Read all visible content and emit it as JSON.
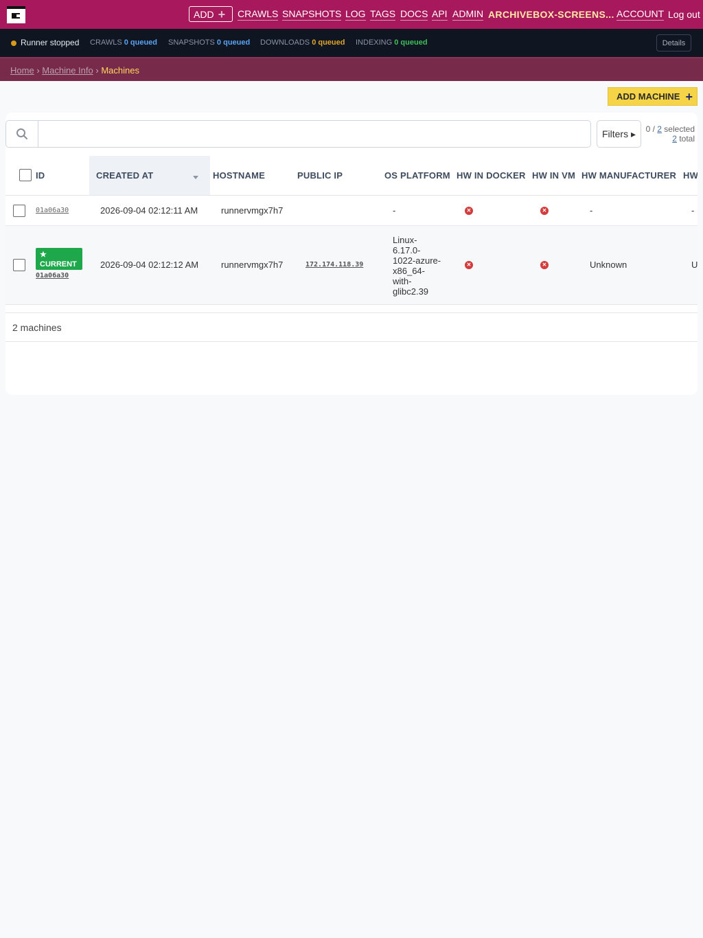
{
  "nav": {
    "add_label": "ADD",
    "links": [
      "CRAWLS",
      "SNAPSHOTS",
      "LOG",
      "TAGS",
      "DOCS",
      "API",
      "ADMIN"
    ],
    "user_label": "ARCHIVEBOX-SCREENS...",
    "account_label": "ACCOUNT",
    "logout_label": "Log out"
  },
  "status": {
    "runner": "Runner stopped",
    "crawls_label": "CRAWLS",
    "crawls_value": "0 queued",
    "snapshots_label": "SNAPSHOTS",
    "snapshots_value": "0 queued",
    "downloads_label": "DOWNLOADS",
    "downloads_value": "0 queued",
    "indexing_label": "INDEXING",
    "indexing_value": "0 queued",
    "details_label": "Details",
    "colors": {
      "crawls": "#5aa3f0",
      "snapshots": "#5aa3f0",
      "downloads": "#e0a52a",
      "indexing": "#3fbf5a",
      "runner_dot": "#d99a1a"
    }
  },
  "breadcrumb": {
    "home": "Home",
    "sep": "›",
    "section": "Machine Info",
    "current": "Machines"
  },
  "toolbar": {
    "add_machine_label": "ADD MACHINE",
    "filters_label": "Filters ▸",
    "selected_prefix": "0 / ",
    "selected_count": "2",
    "selected_suffix": " selected",
    "total_count": "2",
    "total_suffix": " total"
  },
  "table": {
    "headers": [
      "ID",
      "CREATED AT",
      "HOSTNAME",
      "PUBLIC IP",
      "OS PLATFORM",
      "HW IN DOCKER",
      "HW IN VM",
      "HW MANUFACTURER",
      "HW"
    ],
    "rows": [
      {
        "id": "01a06a30",
        "created_at": "2026-09-04 02:12:11 AM",
        "hostname": "runnervmgx7h7",
        "public_ip": "",
        "os_platform": "-",
        "hw_in_docker": "✕",
        "hw_in_vm": "✕",
        "hw_manufacturer": "-",
        "hw_extra": "-"
      },
      {
        "badge": "★\nCURRENT",
        "badge_star": "★",
        "badge_text": "CURRENT",
        "id": "01a06a30",
        "created_at": "2026-09-04 02:12:12 AM",
        "hostname": "runnervmgx7h7",
        "public_ip": "172.174.118.39",
        "os_lines": [
          "Linux-",
          "6.17.0-",
          "1022-azure-",
          "x86_64-",
          "with-",
          "glibc2.39"
        ],
        "hw_in_docker": "✕",
        "hw_in_vm": "✕",
        "hw_manufacturer": "Unknown",
        "hw_extra": "U"
      }
    ],
    "footer": "2 machines"
  }
}
